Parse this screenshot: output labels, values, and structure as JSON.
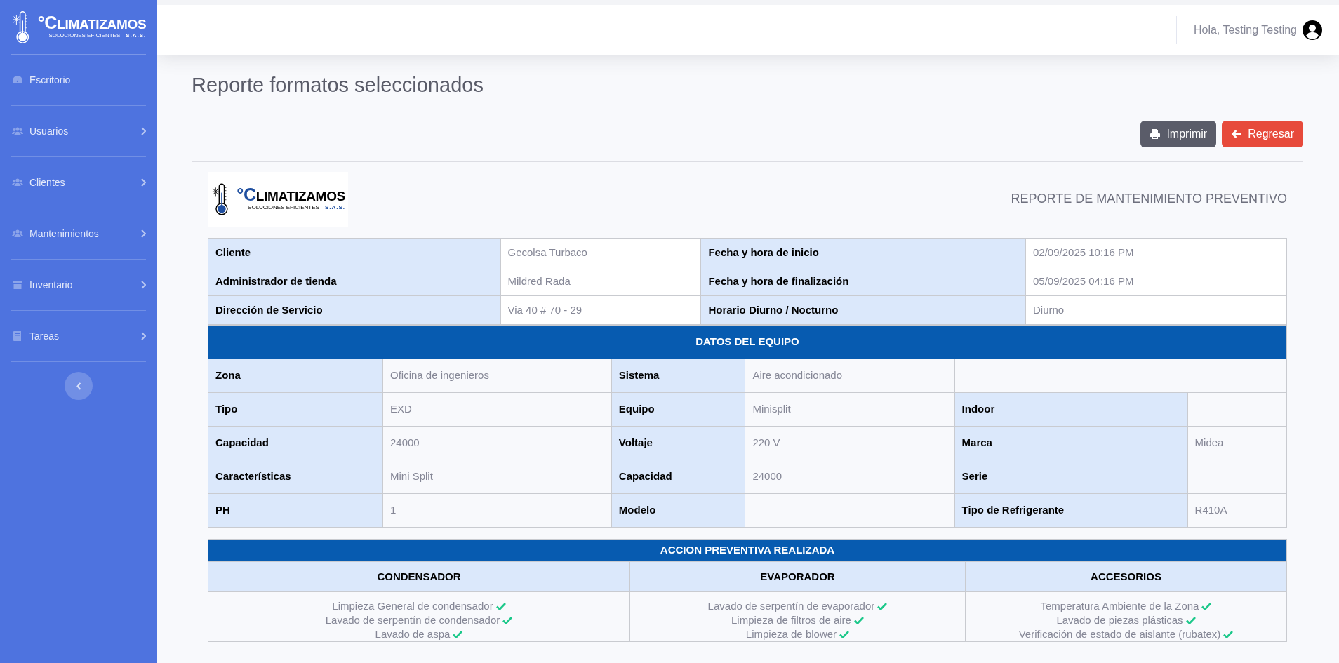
{
  "sidebar": {
    "logo": {
      "mark": "°",
      "name": "CLIMATIZAMOS",
      "tagline": "SOLUCIONES EFICIENTES",
      "suffix": "S.A.S."
    },
    "items": [
      {
        "label": "Escritorio",
        "kind": "gauge",
        "has_submenu": false
      },
      {
        "label": "Usuarios",
        "kind": "users",
        "has_submenu": true
      },
      {
        "label": "Clientes",
        "kind": "users",
        "has_submenu": true
      },
      {
        "label": "Mantenimientos",
        "kind": "users",
        "has_submenu": true
      },
      {
        "label": "Inventario",
        "kind": "box",
        "has_submenu": true
      },
      {
        "label": "Tareas",
        "kind": "book",
        "has_submenu": true
      }
    ]
  },
  "header": {
    "greeting": "Hola, Testing Testing"
  },
  "page_title": "Reporte formatos seleccionados",
  "buttons": [
    {
      "label": "Imprimir",
      "kind": "print"
    },
    {
      "label": "Regresar",
      "kind": "back"
    }
  ],
  "report": {
    "logo": {
      "mark": "°",
      "name": "CLIMATIZAMOS",
      "tagline": "SOLUCIONES EFICIENTES",
      "suffix": "S.A.S."
    },
    "title": "REPORTE DE MANTENIMIENTO PREVENTIVO",
    "info_rows": [
      [
        {
          "label": "Cliente",
          "value": "Gecolsa Turbaco"
        },
        {
          "label": "Fecha y hora de inicio",
          "value": "02/09/2025 10:16 PM"
        }
      ],
      [
        {
          "label": "Administrador de tienda",
          "value": "Mildred Rada"
        },
        {
          "label": "Fecha y hora de finalización",
          "value": "05/09/2025 04:16 PM"
        }
      ],
      [
        {
          "label": "Dirección de Servicio",
          "value": "Via 40 # 70 - 29"
        },
        {
          "label": "Horario Diurno / Nocturno",
          "value": "Diurno"
        }
      ]
    ],
    "equipment": {
      "title": "DATOS DEL EQUIPO",
      "rows": [
        [
          {
            "label": "Zona",
            "value": "Oficina de ingenieros"
          },
          {
            "label": "Sistema",
            "value": "Aire acondicionado"
          }
        ],
        [
          {
            "label": "Tipo",
            "value": "EXD"
          },
          {
            "label": "Equipo",
            "value": "Minisplit"
          },
          {
            "label": "Indoor"
          }
        ],
        [
          {
            "label": "Capacidad",
            "value": "24000"
          },
          {
            "label": "Voltaje",
            "value": "220 V"
          },
          {
            "label": "Marca",
            "value": "Midea"
          }
        ],
        [
          {
            "label": "Características",
            "value": "Mini Split"
          },
          {
            "label": "Capacidad",
            "value": "24000"
          },
          {
            "label": "Serie"
          }
        ],
        [
          {
            "label": "PH",
            "value": "1"
          },
          {
            "label": "Modelo"
          },
          {
            "label": "Tipo de Refrigerante",
            "value": "R410A"
          }
        ]
      ]
    },
    "actions": {
      "title": "ACCION PREVENTIVA REALIZADA",
      "columns": [
        {
          "heading": "CONDENSADOR",
          "items": [
            {
              "text": "Limpieza General de condensador",
              "checked": true
            },
            {
              "text": "Lavado de serpentín de condensador",
              "checked": true
            },
            {
              "text": "Lavado de aspa",
              "checked": true
            }
          ]
        },
        {
          "heading": "EVAPORADOR",
          "items": [
            {
              "text": "Lavado de serpentín de evaporador",
              "checked": true
            },
            {
              "text": "Limpieza de filtros de aire",
              "checked": true
            },
            {
              "text": "Limpieza de blower",
              "checked": true
            }
          ]
        },
        {
          "heading": "ACCESORIOS",
          "items": [
            {
              "text": "Temperatura Ambiente de la Zona",
              "checked": true
            },
            {
              "text": "Lavado de piezas plásticas",
              "checked": true
            },
            {
              "text": "Verificación de estado de aislante (rubatex)",
              "checked": true
            }
          ]
        }
      ]
    }
  }
}
